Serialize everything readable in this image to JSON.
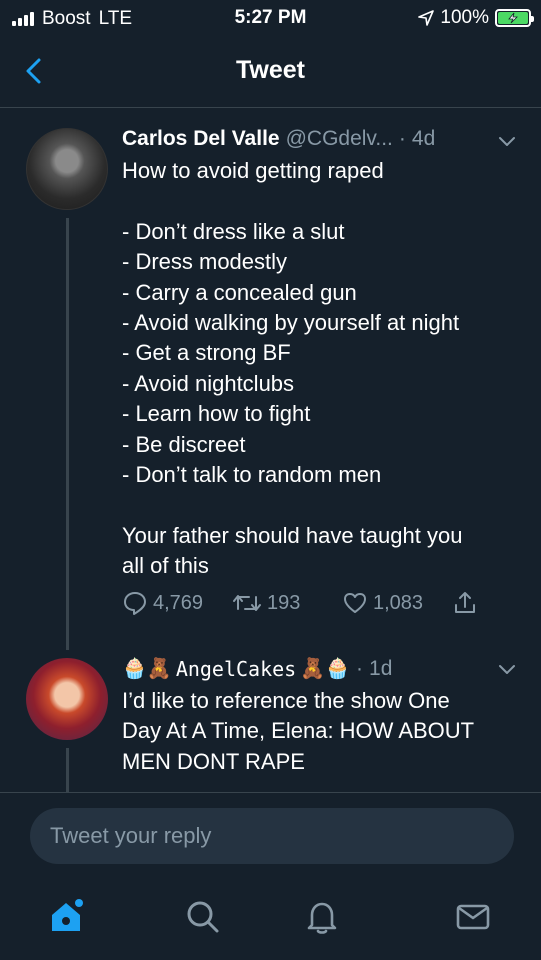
{
  "status_bar": {
    "carrier": "Boost",
    "network": "LTE",
    "time": "5:27 PM",
    "battery": "100%",
    "battery_level": 1.0
  },
  "header": {
    "title": "Tweet",
    "back_icon": "chevron-left-icon"
  },
  "tweet": {
    "name": "Carlos Del Valle",
    "handle": "@CGdelv...",
    "dot": "·",
    "time": "4d",
    "lines": [
      "How to avoid getting raped",
      "",
      "- Don’t dress like a slut",
      "- Dress modestly",
      "- Carry a concealed gun",
      "- Avoid walking by yourself at night",
      "- Get a strong BF",
      "- Avoid nightclubs",
      "- Learn how to fight",
      "- Be discreet",
      "- Don’t talk to random men",
      "",
      "Your father should have taught you",
      "all of this"
    ],
    "replies": "4,769",
    "retweets": "193",
    "likes": "1,083"
  },
  "reply": {
    "name": "AngelCakes",
    "emoji_left": "🧁🧸",
    "emoji_right": "🧸🧁",
    "dot": "·",
    "time": "1d",
    "lines": [
      "I’d like to reference the show One",
      "Day At A Time, Elena: HOW ABOUT",
      "MEN DONT RAPE"
    ]
  },
  "composer": {
    "placeholder": "Tweet your reply"
  },
  "tabbar": {
    "items": [
      "home-icon",
      "search-icon",
      "notifications-icon",
      "messages-icon"
    ]
  },
  "colors": {
    "background": "#15202b",
    "accent": "#1da1f2",
    "muted": "#8899a6",
    "border": "#38444d",
    "battery": "#4cd964"
  }
}
